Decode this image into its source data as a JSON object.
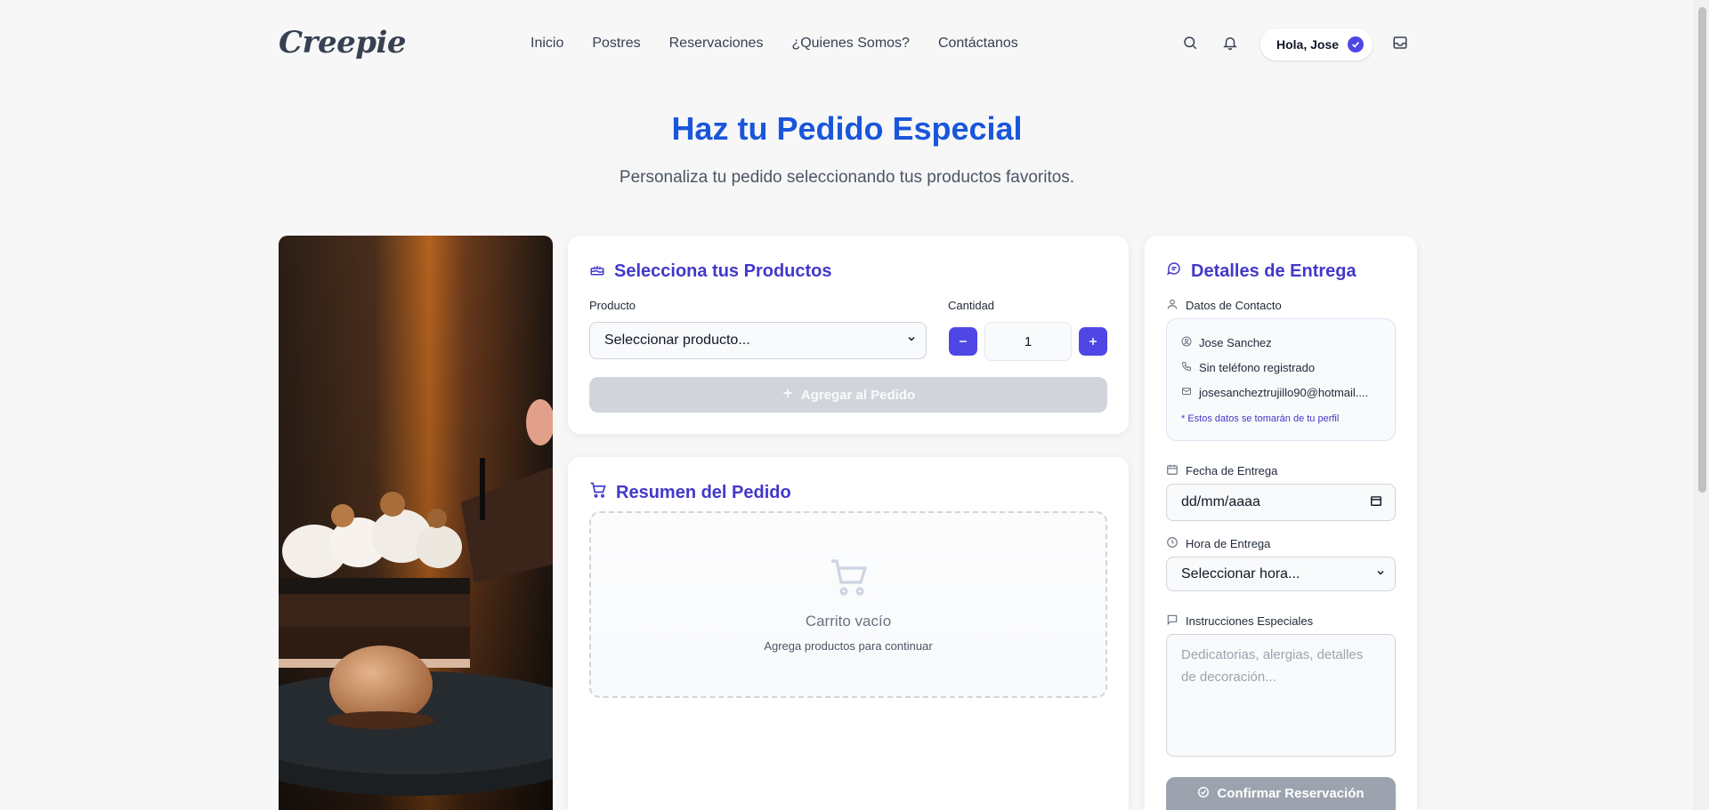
{
  "header": {
    "logo": "Creepie",
    "nav": [
      "Inicio",
      "Postres",
      "Reservaciones",
      "¿Quienes Somos?",
      "Contáctanos"
    ],
    "user_greeting": "Hola, Jose"
  },
  "hero": {
    "title": "Haz tu Pedido Especial",
    "subtitle": "Personaliza tu pedido seleccionando tus productos favoritos."
  },
  "products": {
    "title": "Selecciona tus Productos",
    "product_label": "Producto",
    "product_select": "Seleccionar producto...",
    "quantity_label": "Cantidad",
    "quantity_value": "1",
    "add_button": "Agregar al Pedido"
  },
  "summary": {
    "title": "Resumen del Pedido",
    "empty_title": "Carrito vacío",
    "empty_sub": "Agrega productos para continuar"
  },
  "delivery": {
    "title": "Detalles de Entrega",
    "contact_label": "Datos de Contacto",
    "contact_name": "Jose Sanchez",
    "contact_phone": "Sin teléfono registrado",
    "contact_email": "josesancheztrujillo90@hotmail....",
    "contact_note": "* Estos datos se tomarán de tu perfil",
    "date_label": "Fecha de Entrega",
    "date_value": "dd/mm/aaaa",
    "time_label": "Hora de Entrega",
    "time_select": "Seleccionar hora...",
    "instructions_label": "Instrucciones Especiales",
    "instructions_placeholder": "Dedicatorias, alergias, detalles de decoración...",
    "confirm_button": "Confirmar Reservación"
  },
  "colors": {
    "accent": "#4f46e5",
    "title_blue": "#1a56db",
    "card_title": "#4338ca",
    "disabled": "#d1d5db"
  }
}
